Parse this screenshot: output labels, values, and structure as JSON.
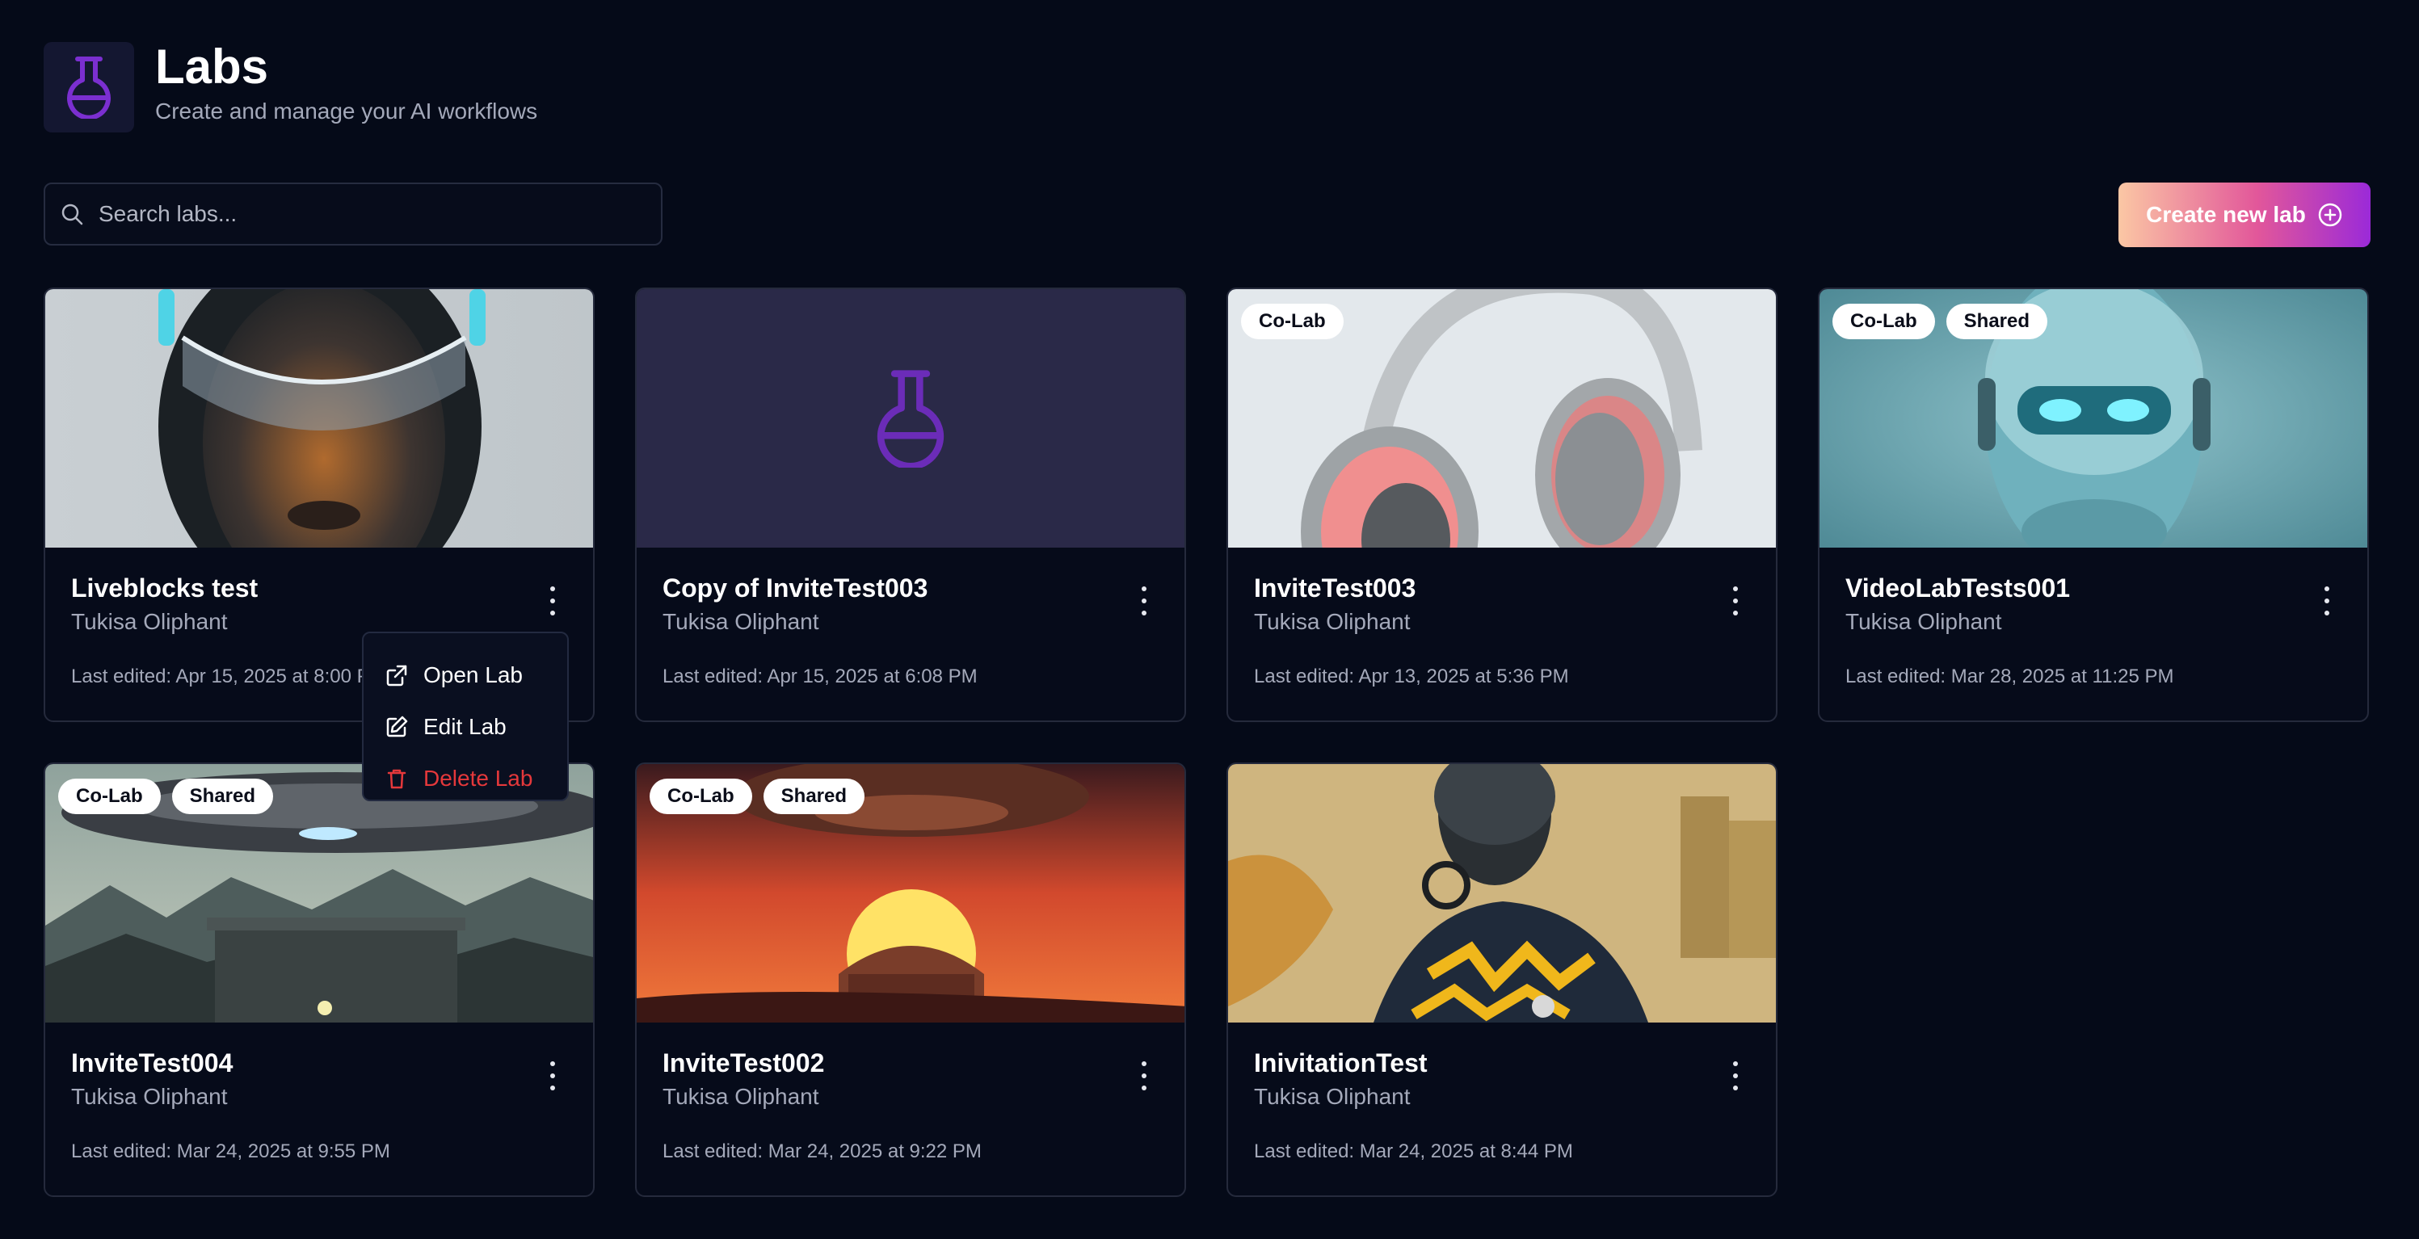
{
  "page": {
    "title": "Labs",
    "subtitle": "Create and manage your AI workflows"
  },
  "search": {
    "placeholder": "Search labs...",
    "value": ""
  },
  "create_button": {
    "label": "Create new lab"
  },
  "cards": [
    {
      "title": "Liveblocks test",
      "owner": "Tukisa Oliphant",
      "edited": "Last edited: Apr 15, 2025 at 8:00 PM",
      "badges": []
    },
    {
      "title": "Copy of InviteTest003",
      "owner": "Tukisa Oliphant",
      "edited": "Last edited: Apr 15, 2025 at 6:08 PM",
      "badges": []
    },
    {
      "title": "InviteTest003",
      "owner": "Tukisa Oliphant",
      "edited": "Last edited: Apr 13, 2025 at 5:36 PM",
      "badges": [
        "Co-Lab"
      ]
    },
    {
      "title": "VideoLabTests001",
      "owner": "Tukisa Oliphant",
      "edited": "Last edited: Mar 28, 2025 at 11:25 PM",
      "badges": [
        "Co-Lab",
        "Shared"
      ]
    },
    {
      "title": "InviteTest004",
      "owner": "Tukisa Oliphant",
      "edited": "Last edited: Mar 24, 2025 at 9:55 PM",
      "badges": [
        "Co-Lab",
        "Shared"
      ]
    },
    {
      "title": "InviteTest002",
      "owner": "Tukisa Oliphant",
      "edited": "Last edited: Mar 24, 2025 at 9:22 PM",
      "badges": [
        "Co-Lab",
        "Shared"
      ]
    },
    {
      "title": "InivitationTest",
      "owner": "Tukisa Oliphant",
      "edited": "Last edited: Mar 24, 2025 at 8:44 PM",
      "badges": []
    }
  ],
  "context_menu": {
    "open": "Open Lab",
    "edit": "Edit Lab",
    "delete": "Delete Lab"
  },
  "colors": {
    "background": "#050a18",
    "accent_purple": "#7b2fd0",
    "danger": "#e5383b"
  }
}
